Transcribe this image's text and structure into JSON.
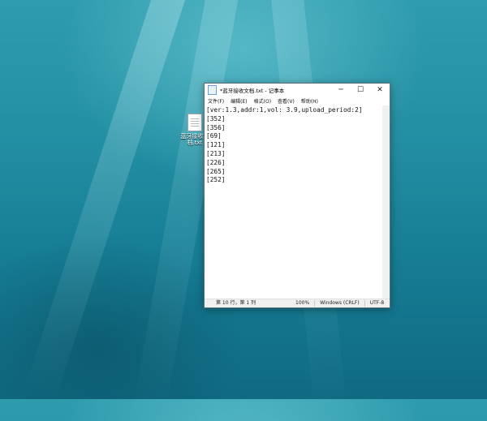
{
  "desktop": {
    "icon_label": "蓝牙接收文档.txt"
  },
  "window": {
    "title": "*蓝牙接收文档.txt - 记事本",
    "menu": [
      "文件(F)",
      "编辑(E)",
      "格式(O)",
      "查看(V)",
      "帮助(H)"
    ],
    "buttons": {
      "minimize": "─",
      "maximize": "☐",
      "close": "✕"
    },
    "lines": [
      "[ver:1.3,addr:1,vol: 3.9,upload_period:2]",
      "[352]",
      "[356]",
      "[69]",
      "[121]",
      "[213]",
      "[226]",
      "[265]",
      "[252]"
    ],
    "status": {
      "position": "第 10 行，第 1 列",
      "zoom": "100%",
      "line_ending": "Windows (CRLF)",
      "encoding": "UTF-8"
    }
  }
}
